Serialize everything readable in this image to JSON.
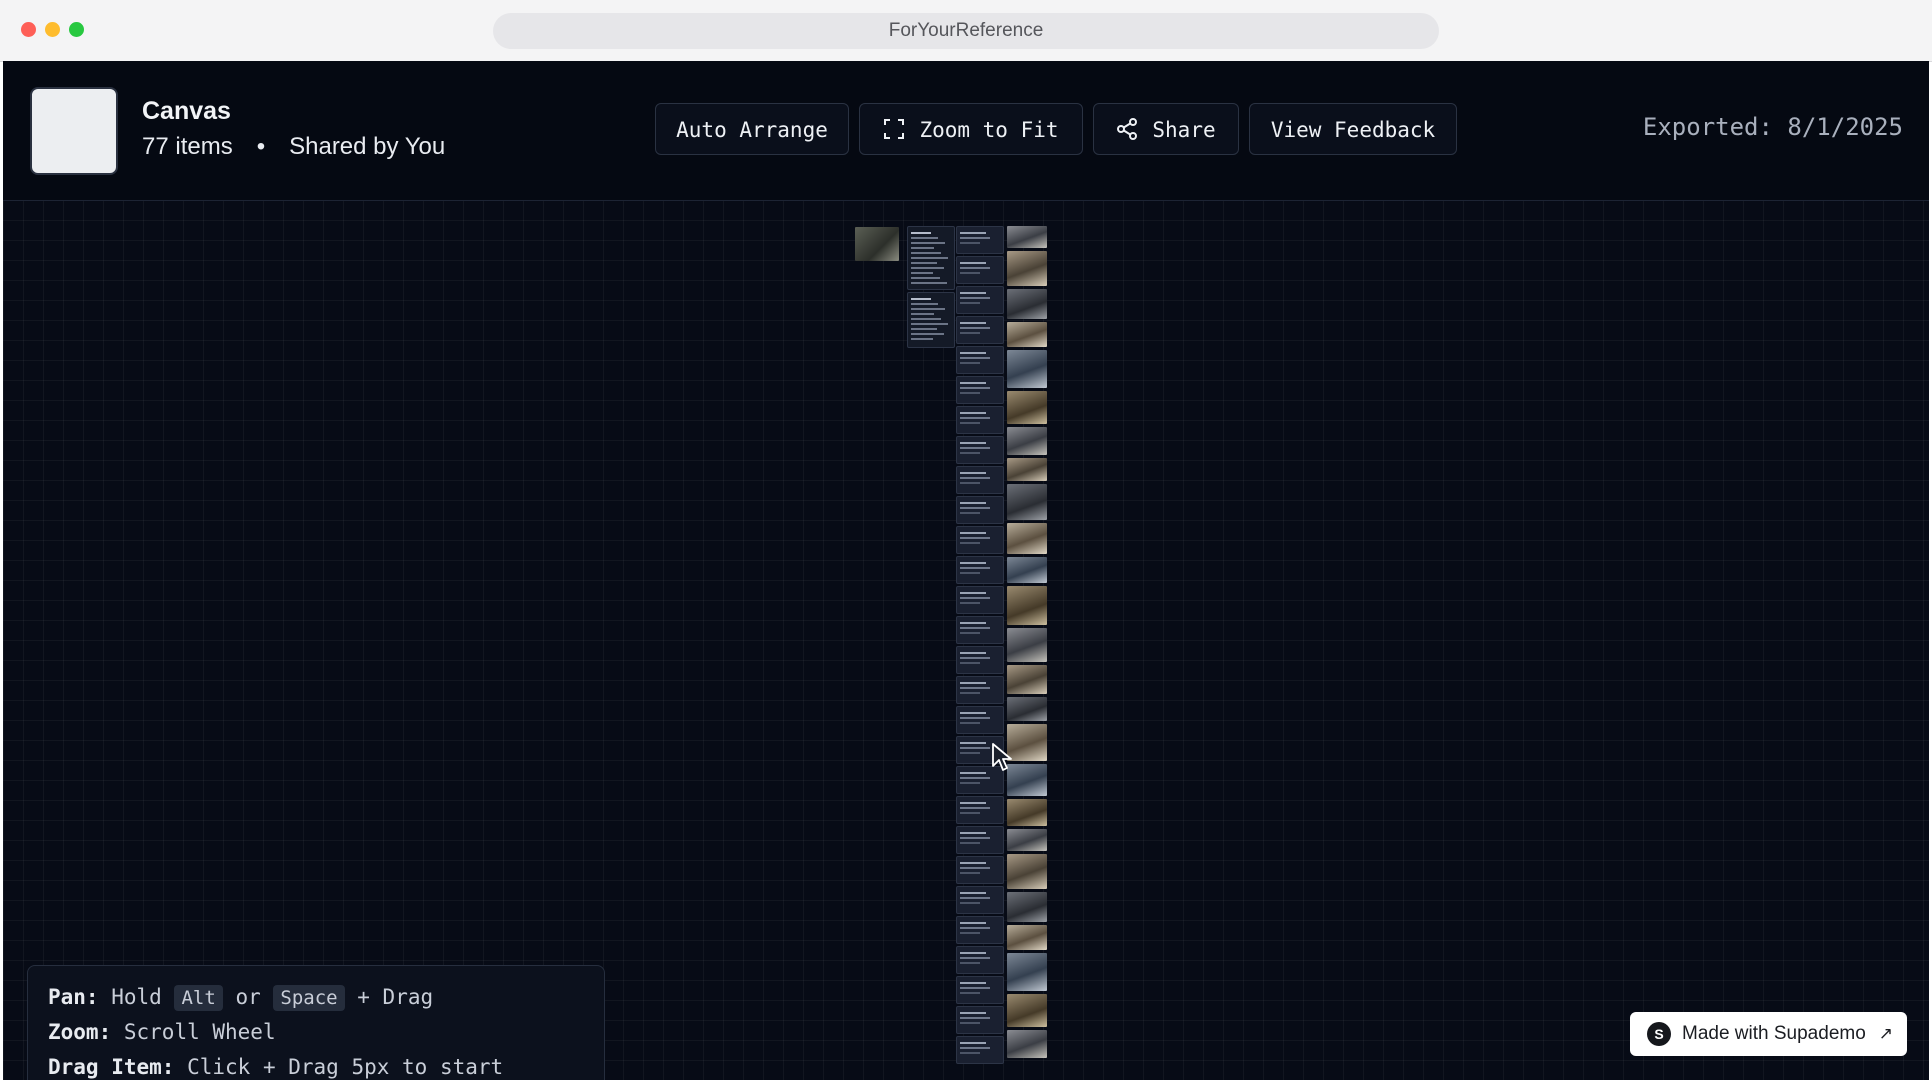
{
  "browser": {
    "url_title": "ForYourReference"
  },
  "header": {
    "title": "Canvas",
    "item_count": "77 items",
    "separator": "•",
    "shared_by": "Shared by You",
    "buttons": {
      "auto_arrange": "Auto Arrange",
      "zoom_to_fit": "Zoom to Fit",
      "share": "Share",
      "view_feedback": "View Feedback"
    },
    "exported": "Exported: 8/1/2025"
  },
  "help": {
    "pan_label": "Pan:",
    "pan_prefix": "Hold",
    "pan_key1": "Alt",
    "pan_or": "or",
    "pan_key2": "Space",
    "pan_suffix": "+ Drag",
    "zoom_label": "Zoom:",
    "zoom_value": "Scroll Wheel",
    "drag_label": "Drag Item:",
    "drag_value": "Click + Drag 5px to start"
  },
  "badge": {
    "logo": "S",
    "text": "Made with Supademo",
    "arrow": "↗"
  },
  "colors": {
    "background": "#060a14",
    "button_border": "#2a3242",
    "text": "#eef1f5",
    "muted": "#a9b0bd"
  },
  "icons": [
    "expand-icon",
    "share-nodes-icon",
    "cursor-arrow-icon"
  ]
}
